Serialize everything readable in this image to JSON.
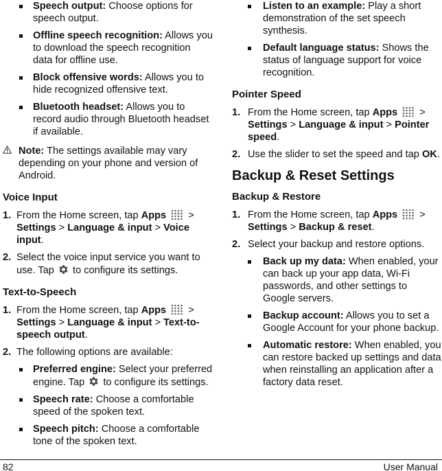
{
  "left_column": {
    "top_bullets": [
      {
        "term": "Speech output:",
        "desc": " Choose options for speech output."
      },
      {
        "term": "Offline speech recognition:",
        "desc": " Allows you to download the speech recognition data for offline use."
      },
      {
        "term": "Block offensive words:",
        "desc": " Allows you to hide recognized offensive text."
      },
      {
        "term": "Bluetooth headset:",
        "desc": " Allows you to record audio through Bluetooth headset if available."
      }
    ],
    "note": {
      "icon": "warning-icon",
      "label": "Note:",
      "text": " The settings available may vary depending on your phone and version of Android."
    },
    "voice_input": {
      "heading": "Voice Input",
      "steps": [
        {
          "num": "1.",
          "pre": "From the Home screen, tap ",
          "apps": "Apps",
          "sep1": " > ",
          "settings": "Settings",
          "sep2": " > ",
          "lang": "Language & input",
          "sep3": " > ",
          "target": "Voice input",
          "end": "."
        },
        {
          "num": "2.",
          "pre": "Select the voice input service you want to use. Tap ",
          "post": " to configure its settings."
        }
      ]
    },
    "tts": {
      "heading": "Text-to-Speech",
      "steps": [
        {
          "num": "1.",
          "pre": "From the Home screen, tap ",
          "apps": "Apps",
          "sep1": " > ",
          "settings": "Settings",
          "sep2": " > ",
          "lang": "Language & input",
          "sep3": " > ",
          "target": "Text-to-speech output",
          "end": "."
        },
        {
          "num": "2.",
          "text": "The following options are available:"
        }
      ],
      "bullets": [
        {
          "term": "Preferred engine:",
          "pre": " Select your preferred engine. Tap ",
          "post": " to configure its settings."
        },
        {
          "term": "Speech rate:",
          "desc": " Choose a comfortable speed of the spoken text."
        },
        {
          "term": "Speech pitch:",
          "desc": " Choose a comfortable tone of the spoken text."
        }
      ]
    }
  },
  "right_column": {
    "top_bullets": [
      {
        "term": "Listen to an example:",
        "desc": " Play a short demonstration of the set speech synthesis."
      },
      {
        "term": "Default language status:",
        "desc": " Shows the status of language support for voice recognition."
      }
    ],
    "pointer_speed": {
      "heading": "Pointer Speed",
      "steps": [
        {
          "num": "1.",
          "pre": "From the Home screen, tap ",
          "apps": "Apps",
          "sep1": " > ",
          "settings": "Settings",
          "sep2": " > ",
          "lang": "Language & input",
          "sep3": " > ",
          "target": "Pointer speed",
          "end": "."
        },
        {
          "num": "2.",
          "pre": "Use the slider to set the speed and tap ",
          "ok": "OK",
          "end": "."
        }
      ]
    },
    "backup_reset": {
      "title": "Backup & Reset Settings",
      "heading": "Backup & Restore",
      "steps": [
        {
          "num": "1.",
          "pre": "From the Home screen, tap ",
          "apps": "Apps",
          "sep1": " > ",
          "settings": "Settings",
          "sep2": " > ",
          "target": "Backup & reset",
          "end": "."
        },
        {
          "num": "2.",
          "text": "Select your backup and restore options."
        }
      ],
      "bullets": [
        {
          "term": "Back up my data:",
          "desc": " When enabled, your can back up your app data, Wi-Fi passwords, and other settings to Google servers."
        },
        {
          "term": "Backup account:",
          "desc": " Allows you to set a Google Account for your phone backup."
        },
        {
          "term": "Automatic restore:",
          "desc": " When enabled, you can restore backed up settings and data when reinstalling an application after a factory data reset."
        }
      ]
    }
  },
  "footer": {
    "page_number": "82",
    "title": "User Manual"
  },
  "colors": {
    "text": "#111111",
    "icon_gray": "#555555",
    "background": "#ffffff"
  }
}
